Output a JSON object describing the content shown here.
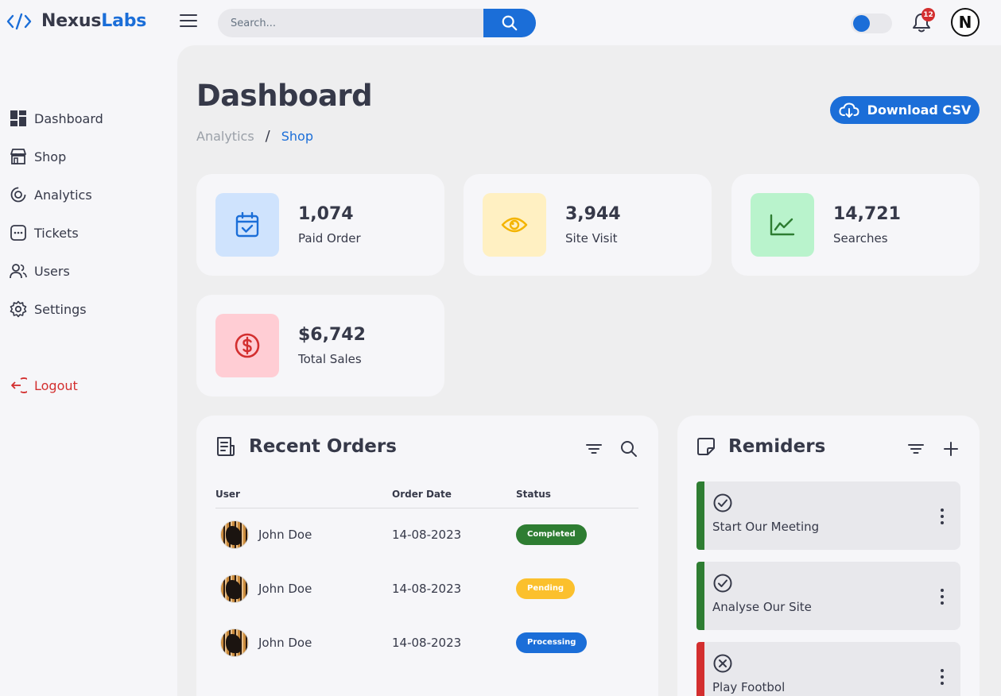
{
  "app": {
    "brand_part1": "Nexus",
    "brand_part2": "Labs",
    "accent_color": "#1b6ed8"
  },
  "topbar": {
    "search_placeholder": "Search...",
    "notification_count": "12",
    "profile_initial": "N",
    "dark_mode_toggle": "on"
  },
  "sidebar": {
    "items": [
      {
        "label": "Dashboard",
        "icon": "dashboard-icon"
      },
      {
        "label": "Shop",
        "icon": "store-icon"
      },
      {
        "label": "Analytics",
        "icon": "analytics-icon"
      },
      {
        "label": "Tickets",
        "icon": "ticket-icon"
      },
      {
        "label": "Users",
        "icon": "users-icon"
      },
      {
        "label": "Settings",
        "icon": "gear-icon"
      }
    ],
    "logout_label": "Logout"
  },
  "header": {
    "title": "Dashboard",
    "breadcrumb": [
      "Analytics",
      "Shop"
    ],
    "breadcrumb_separator": "/",
    "download_label": "Download CSV"
  },
  "stats": [
    {
      "value": "1,074",
      "label": "Paid Order",
      "icon": "calendar-check-icon",
      "color": "#1b6ed8",
      "bg": "#cfe3fd"
    },
    {
      "value": "3,944",
      "label": "Site Visit",
      "icon": "eye-icon",
      "color": "#f4b400",
      "bg": "#fff0c2"
    },
    {
      "value": "14,721",
      "label": "Searches",
      "icon": "line-chart-icon",
      "color": "#2e7d32",
      "bg": "#b9f3cc"
    },
    {
      "value": "$6,742",
      "label": "Total Sales",
      "icon": "dollar-icon",
      "color": "#d32f2f",
      "bg": "#ffcdd4"
    }
  ],
  "orders": {
    "title": "Recent Orders",
    "columns": [
      "User",
      "Order Date",
      "Status"
    ],
    "rows": [
      {
        "user": "John Doe",
        "date": "14-08-2023",
        "status": "Completed",
        "status_class": "completed"
      },
      {
        "user": "John Doe",
        "date": "14-08-2023",
        "status": "Pending",
        "status_class": "pending"
      },
      {
        "user": "John Doe",
        "date": "14-08-2023",
        "status": "Processing",
        "status_class": "processing"
      }
    ]
  },
  "reminders": {
    "title": "Remiders",
    "items": [
      {
        "text": "Start Our Meeting",
        "icon": "check-circle-icon",
        "color": "#2e7d32"
      },
      {
        "text": "Analyse Our Site",
        "icon": "check-circle-icon",
        "color": "#2e7d32"
      },
      {
        "text": "Play Footbol",
        "icon": "x-circle-icon",
        "color": "#d32f2f"
      }
    ]
  }
}
